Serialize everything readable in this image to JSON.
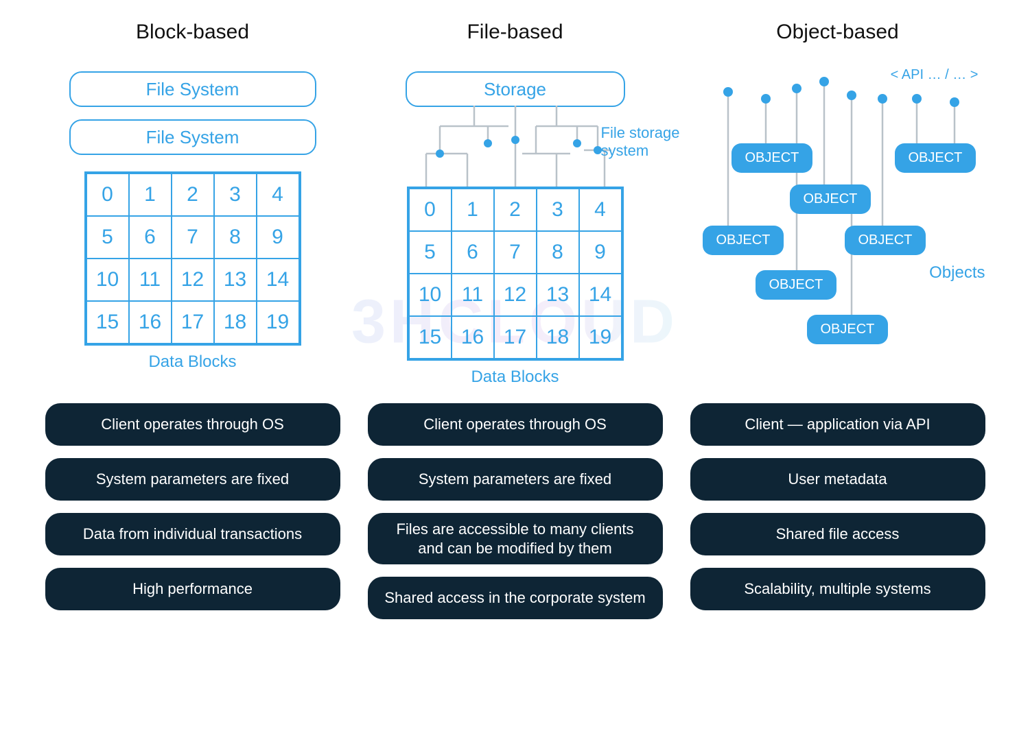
{
  "columns": {
    "block": {
      "title": "Block-based",
      "fs1": "File System",
      "fs2": "File System",
      "grid_label": "Data Blocks",
      "grid": [
        "0",
        "1",
        "2",
        "3",
        "4",
        "5",
        "6",
        "7",
        "8",
        "9",
        "10",
        "11",
        "12",
        "13",
        "14",
        "15",
        "16",
        "17",
        "18",
        "19"
      ],
      "features": [
        "Client operates through OS",
        "System parameters are fixed",
        "Data from individual transactions",
        "High performance"
      ]
    },
    "file": {
      "title": "File-based",
      "storage": "Storage",
      "side_label": "File storage system",
      "grid_label": "Data Blocks",
      "grid": [
        "0",
        "1",
        "2",
        "3",
        "4",
        "5",
        "6",
        "7",
        "8",
        "9",
        "10",
        "11",
        "12",
        "13",
        "14",
        "15",
        "16",
        "17",
        "18",
        "19"
      ],
      "features": [
        "Client operates through OS",
        "System parameters are fixed",
        "Files are accessible to many clients and can be modified by them",
        "Shared access in the corporate system"
      ]
    },
    "object": {
      "title": "Object-based",
      "api_label": "< API … / … >",
      "object_label": "OBJECT",
      "objects_side": "Objects",
      "features": [
        "Client — application via API",
        "User metadata",
        "Shared file access",
        "Scalability, multiple systems"
      ]
    }
  },
  "watermark": "3HCLOUD",
  "colors": {
    "accent": "#35a3e6",
    "dark": "#0e2535"
  }
}
